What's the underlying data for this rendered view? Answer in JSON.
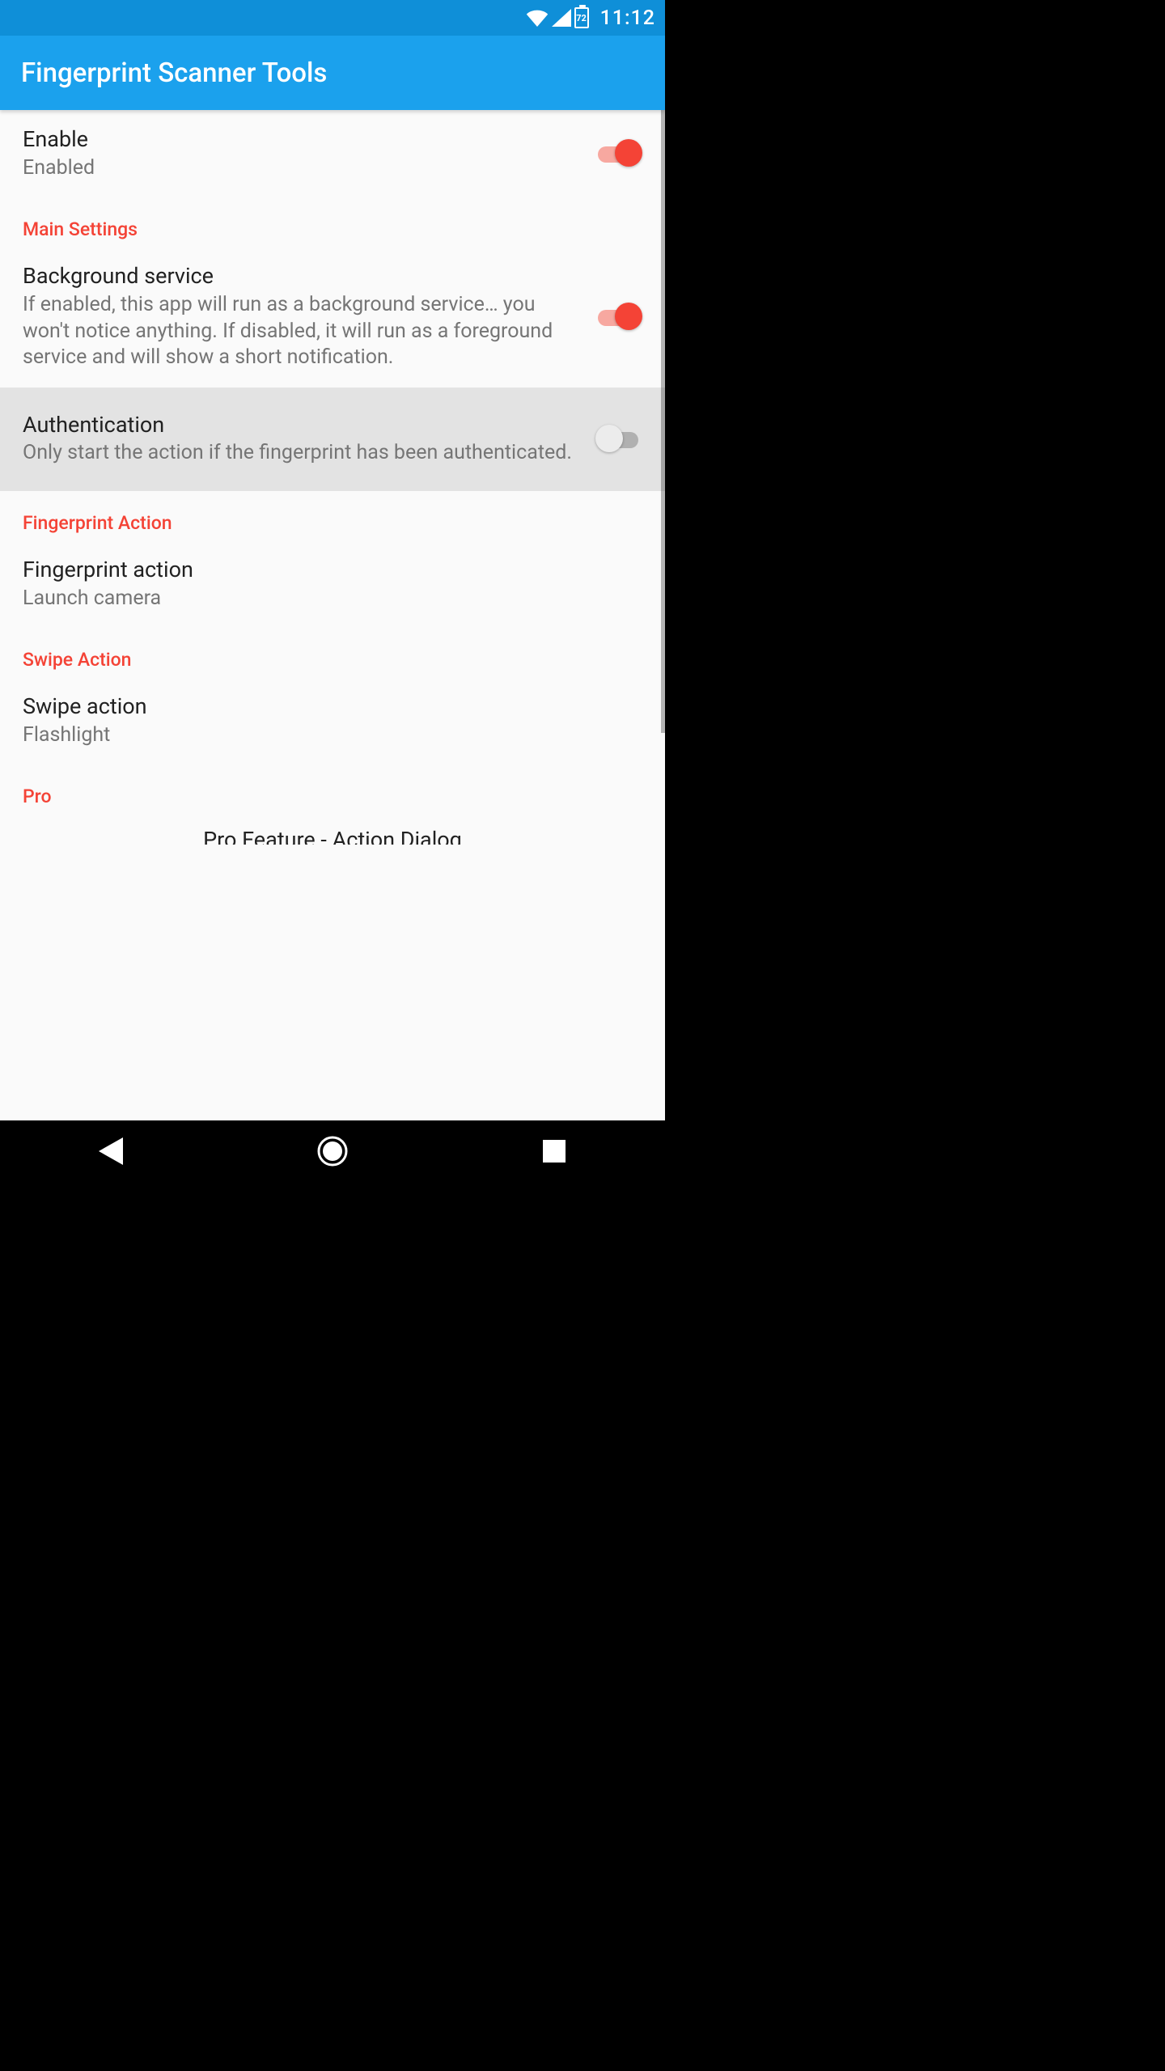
{
  "status": {
    "time": "11:12",
    "battery": "72"
  },
  "app": {
    "title": "Fingerprint Scanner Tools"
  },
  "rows": {
    "enable": {
      "title": "Enable",
      "subtitle": "Enabled"
    },
    "bg": {
      "title": "Background service",
      "subtitle": "If enabled, this app will run as a background service… you won't notice anything. If disabled, it will run as a foreground service and will show a short notification."
    },
    "auth": {
      "title": "Authentication",
      "subtitle": "Only start the action if the fingerprint has been authenticated."
    },
    "fpaction": {
      "title": "Fingerprint action",
      "subtitle": "Launch camera"
    },
    "swipe": {
      "title": "Swipe action",
      "subtitle": "Flashlight"
    },
    "pro_item": "Pro Feature - Action Dialog"
  },
  "sections": {
    "main": "Main Settings",
    "fp": "Fingerprint Action",
    "swipe": "Swipe Action",
    "pro": "Pro"
  }
}
